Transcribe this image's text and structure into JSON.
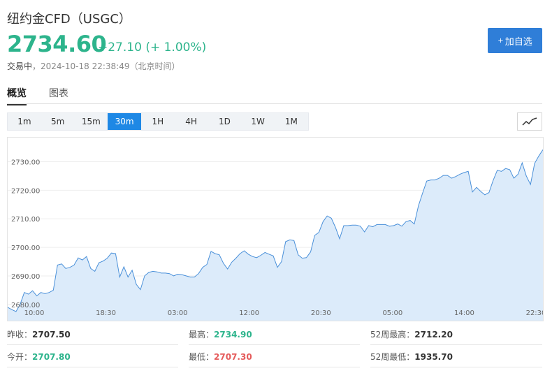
{
  "header": {
    "title": "纽约金CFD（USGC）",
    "price": "2734.60",
    "change": "+27.10 (+ 1.00%)",
    "status": "交易中",
    "timestamp": "，2024-10-18 22:38:49（北京时间）",
    "add_button": "加自选"
  },
  "tabs": [
    {
      "label": "概览",
      "active": true
    },
    {
      "label": "图表",
      "active": false
    }
  ],
  "periods": [
    "1m",
    "5m",
    "15m",
    "30m",
    "1H",
    "4H",
    "1D",
    "1W",
    "1M"
  ],
  "active_period": "30m",
  "icons": {
    "add": "plus-icon",
    "chart_type": "line-chart-icon"
  },
  "colors": {
    "up": "#2db48c",
    "down": "#e55b5b",
    "accent": "#1e88e5",
    "line": "#4a90d9",
    "fill": "#dcebfa"
  },
  "stats": {
    "prev_close": {
      "label": "昨收：",
      "value": "2707.50"
    },
    "open": {
      "label": "今开：",
      "value": "2707.80"
    },
    "high": {
      "label": "最高：",
      "value": "2734.90"
    },
    "low": {
      "label": "最低：",
      "value": "2707.30"
    },
    "high52": {
      "label": "52周最高：",
      "value": "2712.20"
    },
    "low52": {
      "label": "52周最低：",
      "value": "1935.70"
    }
  },
  "chart_data": {
    "type": "area",
    "y_ticks": [
      "2680.00",
      "2690.00",
      "2700.00",
      "2710.00",
      "2720.00",
      "2730.00"
    ],
    "x_ticks": [
      "10:00",
      "18:30",
      "03:00",
      "12:00",
      "20:30",
      "05:00",
      "14:00",
      "22:30"
    ],
    "ylim": [
      2678,
      2735
    ],
    "grid": true,
    "values": [
      2679.0,
      2678.2,
      2677.5,
      2680.0,
      2684.2,
      2683.6,
      2684.8,
      2683.0,
      2684.2,
      2683.8,
      2684.2,
      2685.0,
      2693.8,
      2694.2,
      2692.6,
      2693.0,
      2693.8,
      2696.3,
      2695.6,
      2696.8,
      2692.6,
      2691.6,
      2694.6,
      2695.2,
      2696.2,
      2698.0,
      2697.8,
      2689.6,
      2693.2,
      2689.6,
      2692.0,
      2687.0,
      2685.2,
      2690.0,
      2691.2,
      2691.6,
      2691.4,
      2691.0,
      2691.0,
      2690.8,
      2690.0,
      2690.6,
      2690.4,
      2690.0,
      2689.6,
      2689.6,
      2690.8,
      2693.0,
      2694.0,
      2698.6,
      2697.8,
      2697.4,
      2694.4,
      2692.4,
      2694.8,
      2696.2,
      2697.8,
      2698.8,
      2697.6,
      2696.8,
      2696.4,
      2697.2,
      2698.2,
      2697.6,
      2697.0,
      2693.0,
      2695.0,
      2702.0,
      2702.6,
      2702.4,
      2697.4,
      2696.2,
      2696.4,
      2698.4,
      2704.2,
      2705.2,
      2709.0,
      2711.0,
      2710.2,
      2707.0,
      2703.0,
      2707.6,
      2707.6,
      2707.8,
      2707.8,
      2707.4,
      2705.4,
      2707.6,
      2707.2,
      2708.0,
      2708.0,
      2708.0,
      2707.4,
      2707.6,
      2708.2,
      2707.4,
      2709.0,
      2709.4,
      2708.2,
      2714.6,
      2719.0,
      2723.2,
      2723.6,
      2723.6,
      2724.2,
      2725.2,
      2725.2,
      2724.2,
      2724.8,
      2725.6,
      2726.2,
      2726.6,
      2719.4,
      2721.0,
      2719.6,
      2718.4,
      2719.2,
      2723.4,
      2727.0,
      2726.6,
      2727.6,
      2727.2,
      2724.2,
      2725.6,
      2729.6,
      2725.0,
      2722.0,
      2729.4,
      2732.0,
      2734.2
    ]
  }
}
